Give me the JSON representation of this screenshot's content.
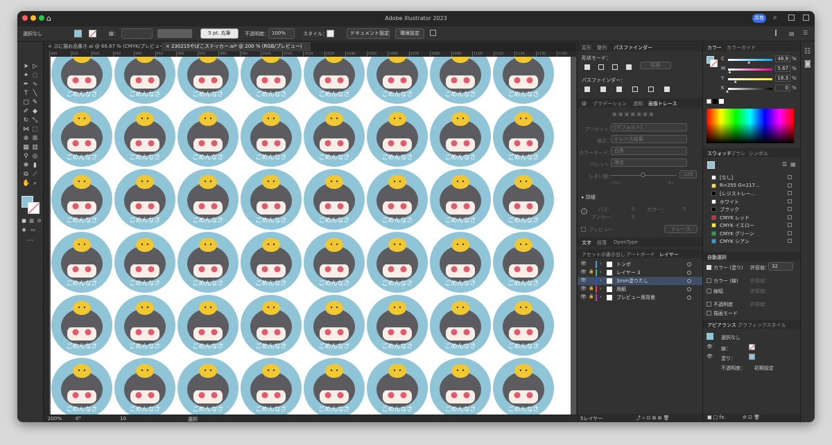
{
  "app": {
    "title": "Adobe Illustrator 2023",
    "share": "共有"
  },
  "control": {
    "selection": "選択なし",
    "stroke_label": "線：",
    "brush": "5 pt. 丸筆",
    "opacity_label": "不透明度：",
    "opacity": "100%",
    "style_label": "スタイル：",
    "doc_settings": "ドキュメント設定",
    "prefs": "環境設定"
  },
  "doc_tabs": [
    {
      "label": "ぷに猫お品書き.ai @ 66.67 % (CMYK/プレビュー)",
      "close": "×"
    },
    {
      "label": "230215やばこステッカー.ai* @ 200 % (RGB/プレビュー)",
      "close": "×"
    }
  ],
  "ruler": [
    "900",
    "910",
    "920",
    "930",
    "940",
    "950",
    "960",
    "970",
    "980",
    "990",
    "1000",
    "1010",
    "1020",
    "1030",
    "1040",
    "1050",
    "1060",
    "1070",
    "1080",
    "1090",
    "1100",
    "1110",
    "1120",
    "1130",
    "1140"
  ],
  "sticker": {
    "text": "ごめんなさ",
    "bg": "#8fc5d6",
    "hair": "#5c5c60",
    "chick": "#f2c832"
  },
  "pathfinder": {
    "tabs": [
      "変形",
      "整列",
      "パスファインダー"
    ],
    "shape_mode": "形状モード：",
    "expand": "拡張",
    "pathfinders": "パスファインダー："
  },
  "trace": {
    "tabs": [
      "線",
      "グラデーション",
      "透明",
      "画像トレース"
    ],
    "preset_label": "プリセット：",
    "preset": "[デフォルト]",
    "view_label": "表示：",
    "view": "トレース結果",
    "mode_label": "カラーモード：",
    "mode": "白黒",
    "palette_label": "パレット：",
    "palette": "限定",
    "threshold_label": "しきい値：",
    "threshold": "128",
    "few": "少ない",
    "many": "多く",
    "details": "詳細",
    "paths_label": "パス：",
    "paths": "0",
    "colors_label": "カラー：",
    "colors": "0",
    "anchors_label": "アンカー：",
    "anchors": "0",
    "preview": "プレビュー",
    "trace_btn": "トレース"
  },
  "text_tabs": [
    "文字",
    "段落",
    "OpenType"
  ],
  "layers": {
    "tabs": [
      "アセットの書き出し",
      "アートボード",
      "レイヤー"
    ],
    "items": [
      {
        "name": "トンボ",
        "color": "#4f9cf9"
      },
      {
        "name": "レイヤー 3",
        "color": "#3dc08a"
      },
      {
        "name": "3mm塗りたし",
        "color": "#2e4ed8"
      },
      {
        "name": "用紙",
        "color": "#e04646"
      },
      {
        "name": "プレビュー用背景",
        "color": "#b040c0"
      }
    ],
    "count": "5レイヤー"
  },
  "color": {
    "tabs": [
      "カラー",
      "カラーガイド"
    ],
    "channels": [
      {
        "k": "C",
        "v": "48.9"
      },
      {
        "k": "M",
        "v": "5.67"
      },
      {
        "k": "Y",
        "v": "18.3"
      },
      {
        "k": "K",
        "v": "0"
      }
    ],
    "pct": "%"
  },
  "swatches": {
    "tabs": [
      "スウォッチ",
      "ブラシ",
      "シンボル"
    ],
    "items": [
      {
        "name": "[なし]",
        "color": "none"
      },
      {
        "name": "R=255 G=217...",
        "color": "#ffd940"
      },
      {
        "name": "[レジストレー...",
        "color": "#000000"
      },
      {
        "name": "ホワイト",
        "color": "#ffffff"
      },
      {
        "name": "ブラック",
        "color": "#000000"
      },
      {
        "name": "CMYK レッド",
        "color": "#e8262a"
      },
      {
        "name": "CMYK イエロー",
        "color": "#fff200"
      },
      {
        "name": "CMYK グリーン",
        "color": "#1ba04a"
      },
      {
        "name": "CMYK シアン",
        "color": "#1fa8e0"
      }
    ]
  },
  "auto_select": {
    "title": "自動選択",
    "fill": "カラー (塗り)",
    "tol_label": "許容値：",
    "tol": "32",
    "stroke": "カラー (線)",
    "width": "線幅",
    "opacity": "不透明度",
    "blend": "描画モード"
  },
  "appearance": {
    "tabs": [
      "アピアランス",
      "グラフィックスタイル"
    ],
    "selection": "選択なし",
    "stroke": "線：",
    "fill": "塗り：",
    "opacity": "不透明度：",
    "opacity_val": "初期設定"
  },
  "status": {
    "zoom": "200%",
    "rotate": "0°",
    "page": "10",
    "tool": "選択"
  }
}
